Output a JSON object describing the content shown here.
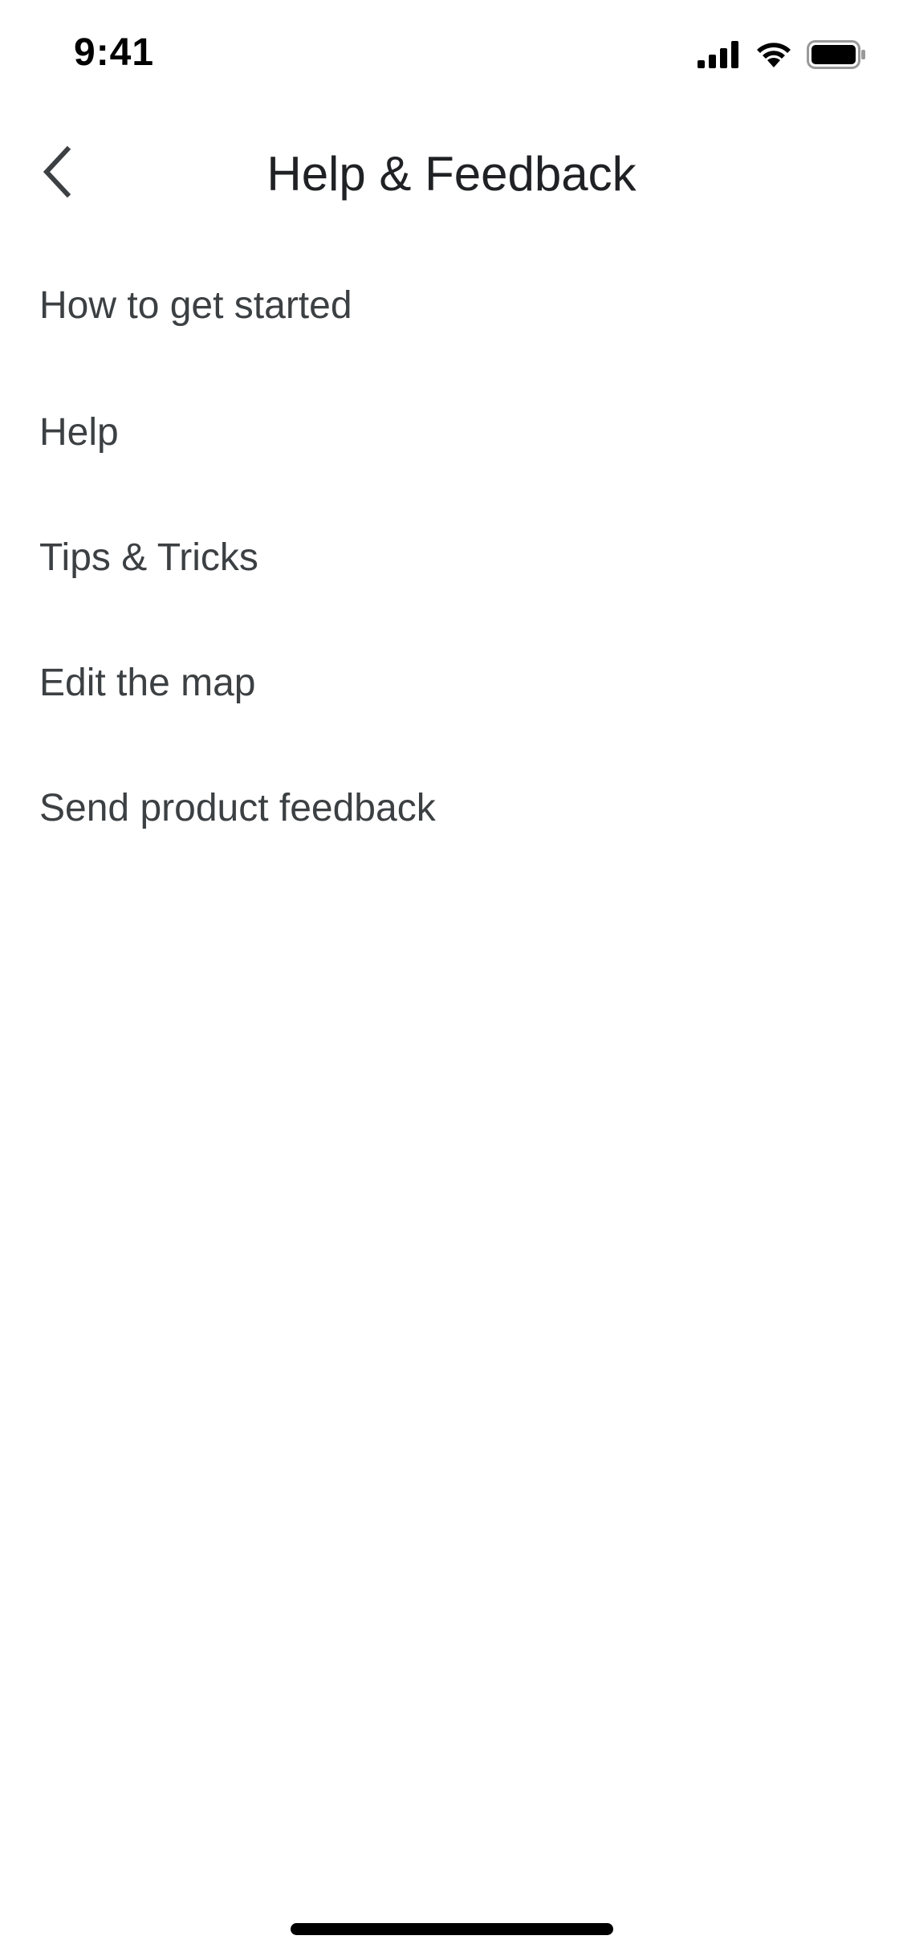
{
  "status_bar": {
    "time": "9:41",
    "icons": [
      "cellular-signal-icon",
      "wifi-icon",
      "battery-icon"
    ]
  },
  "header": {
    "back_icon": "chevron-left-icon",
    "title": "Help & Feedback"
  },
  "menu": {
    "items": [
      {
        "label": "How to get started"
      },
      {
        "label": "Help"
      },
      {
        "label": "Tips & Tricks"
      },
      {
        "label": "Edit the map"
      },
      {
        "label": "Send product feedback"
      }
    ]
  },
  "colors": {
    "background": "#ffffff",
    "title_text": "#202124",
    "item_text": "#3c4043",
    "icon": "#3c4043",
    "status_text": "#000000"
  }
}
